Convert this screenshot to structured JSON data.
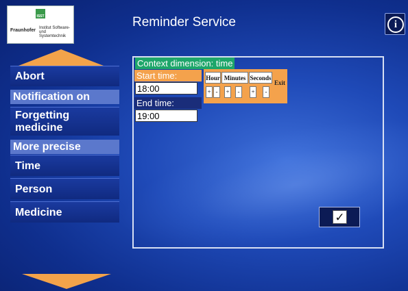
{
  "logo": {
    "brand": "Fraunhofer",
    "subline": "Institut Software- und Systemtechnik",
    "mark": "ISST"
  },
  "header": {
    "title": "Reminder Service",
    "info_icon": "info-icon",
    "info_glyph": "i"
  },
  "sidebar": {
    "scroll_up_icon": "arrow-up-icon",
    "scroll_down_icon": "arrow-down-icon",
    "items": [
      {
        "label": "Abort",
        "kind": "button"
      },
      {
        "label": "Notification on",
        "kind": "section"
      },
      {
        "label": "Forgetting medicine",
        "kind": "button"
      },
      {
        "label": "More precise",
        "kind": "section"
      },
      {
        "label": "Time",
        "kind": "button"
      },
      {
        "label": "Person",
        "kind": "button"
      },
      {
        "label": "Medicine",
        "kind": "button"
      }
    ]
  },
  "panel": {
    "context_label": "Context dimension: time",
    "start_label": "Start time:",
    "start_value": "18:00",
    "end_label": "End time:",
    "end_value": "19:00",
    "picker": {
      "hour": "Hour",
      "minutes": "Minutes",
      "seconds": "Seconds",
      "exit": "Exit",
      "plus": "+",
      "minus": "-"
    },
    "confirm_glyph": "✓",
    "confirm_icon": "checkmark-icon"
  },
  "colors": {
    "accent_orange": "#f4a24c",
    "accent_green": "#1ea66a",
    "background": "#1f4ab8"
  }
}
